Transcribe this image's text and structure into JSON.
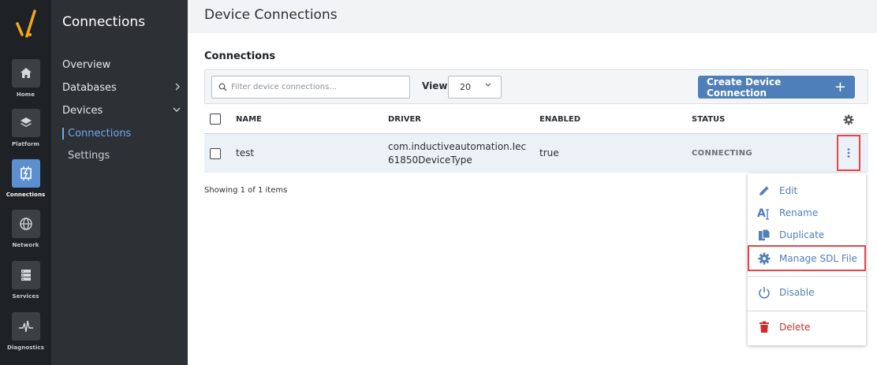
{
  "rail": {
    "items": [
      {
        "label": "Home",
        "icon": "home-icon"
      },
      {
        "label": "Platform",
        "icon": "layers-icon"
      },
      {
        "label": "Connections",
        "icon": "connections-icon"
      },
      {
        "label": "Network",
        "icon": "globe-icon"
      },
      {
        "label": "Services",
        "icon": "server-icon"
      },
      {
        "label": "Diagnostics",
        "icon": "pulse-icon"
      }
    ],
    "active": "Connections"
  },
  "subnav": {
    "title": "Connections",
    "items": [
      {
        "label": "Overview"
      },
      {
        "label": "Databases",
        "chevron": "›"
      },
      {
        "label": "Devices",
        "chevron": "⌄"
      }
    ],
    "sub_items": [
      {
        "label": "Connections",
        "selected": true
      },
      {
        "label": "Settings",
        "selected": false
      }
    ]
  },
  "page": {
    "title": "Device Connections",
    "section_title": "Connections"
  },
  "toolbar": {
    "filter_placeholder": "Filter device connections...",
    "view_label": "View",
    "view_value": "20",
    "create_label": "Create Device Connection",
    "create_icon": "+"
  },
  "table": {
    "headers": [
      "NAME",
      "DRIVER",
      "ENABLED",
      "STATUS"
    ],
    "rows": [
      {
        "name": "test",
        "driver_line1": "com.inductiveautomation.Iec",
        "driver_line2": "61850DeviceType",
        "enabled": "true",
        "status": "CONNECTING"
      }
    ],
    "showing": "Showing 1 of 1 items"
  },
  "menu": {
    "items": [
      {
        "label": "Edit",
        "icon": "pencil-icon"
      },
      {
        "label": "Rename",
        "icon": "rename-icon"
      },
      {
        "label": "Duplicate",
        "icon": "duplicate-icon"
      },
      {
        "label": "Manage SDL File",
        "icon": "gear-icon"
      },
      {
        "label": "Disable",
        "icon": "power-icon"
      },
      {
        "label": "Delete",
        "icon": "trash-icon"
      }
    ]
  },
  "colors": {
    "accent": "#4f7fb8",
    "active_rail": "#5b8fd0",
    "highlight_border": "#e04848",
    "danger": "#c9302c"
  }
}
